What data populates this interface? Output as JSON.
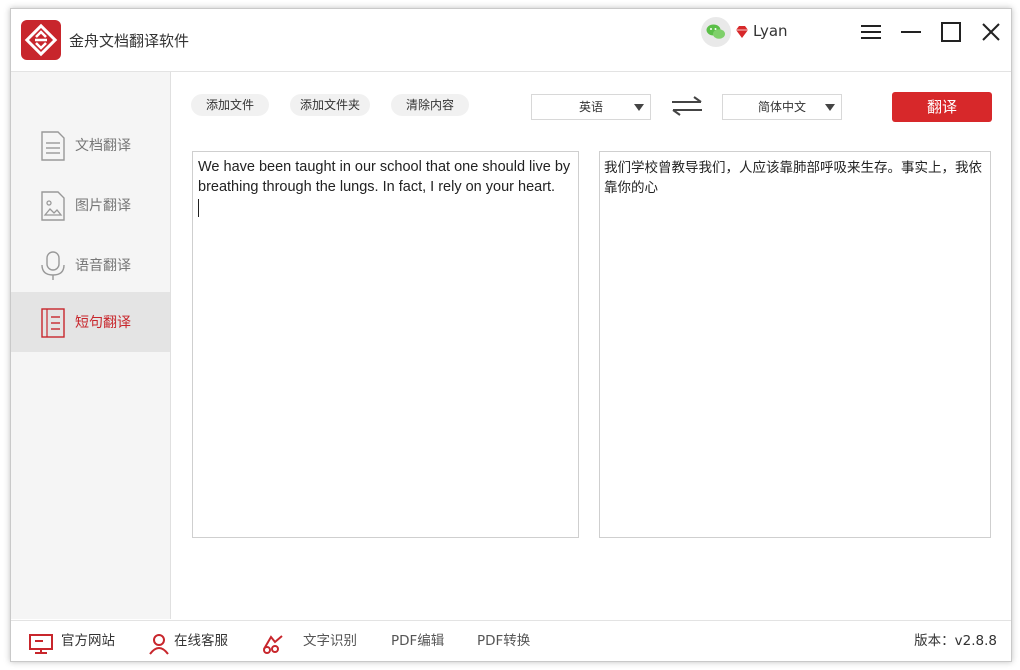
{
  "app": {
    "title": "金舟文档翻译软件",
    "username": "Lyan"
  },
  "toolbar": {
    "add_file": "添加文件",
    "add_folder": "添加文件夹",
    "clear": "清除内容",
    "translate": "翻译"
  },
  "languages": {
    "source": "英语",
    "target": "简体中文"
  },
  "sidebar": {
    "items": [
      {
        "label": "文档翻译",
        "icon": "document-icon",
        "active": false
      },
      {
        "label": "图片翻译",
        "icon": "image-icon",
        "active": false
      },
      {
        "label": "语音翻译",
        "icon": "microphone-icon",
        "active": false
      },
      {
        "label": "短句翻译",
        "icon": "sentence-icon",
        "active": true
      }
    ]
  },
  "source_text": "We have been taught in our school that one should live by breathing through the lungs. In fact, I rely on your heart.",
  "target_text": "我们学校曾教导我们，人应该靠肺部呼吸来生存。事实上，我依靠你的心",
  "footer": {
    "website": "官方网站",
    "support": "在线客服",
    "ocr": "文字识别",
    "pdf_edit": "PDF编辑",
    "pdf_convert": "PDF转换",
    "version": "版本：v2.8.8"
  },
  "colors": {
    "accent": "#d7282a",
    "brand": "#c8262c",
    "sidebar_bg": "#f5f5f5",
    "active_bg": "#e4e4e4"
  }
}
